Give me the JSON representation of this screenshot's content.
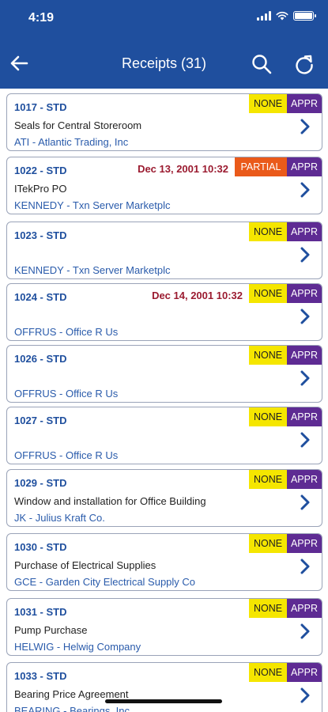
{
  "status": {
    "time": "4:19"
  },
  "nav": {
    "title": "Receipts (31)"
  },
  "receipts": [
    {
      "id": "1017 - STD",
      "description": "Seals for Central Storeroom",
      "vendor": "ATI - Atlantic Trading, Inc",
      "date": "",
      "receive_status": "NONE",
      "approval": "APPR"
    },
    {
      "id": "1022 - STD",
      "description": "ITekPro PO",
      "vendor": "KENNEDY - Txn Server Marketplc",
      "date": "Dec 13, 2001 10:32",
      "receive_status": "PARTIAL",
      "approval": "APPR"
    },
    {
      "id": "1023 - STD",
      "description": "",
      "vendor": "KENNEDY - Txn Server Marketplc",
      "date": "",
      "receive_status": "NONE",
      "approval": "APPR"
    },
    {
      "id": "1024 - STD",
      "description": "",
      "vendor": "OFFRUS - Office R Us",
      "date": "Dec 14, 2001 10:32",
      "receive_status": "NONE",
      "approval": "APPR"
    },
    {
      "id": "1026 - STD",
      "description": "",
      "vendor": "OFFRUS - Office R Us",
      "date": "",
      "receive_status": "NONE",
      "approval": "APPR"
    },
    {
      "id": "1027 - STD",
      "description": "",
      "vendor": "OFFRUS - Office R Us",
      "date": "",
      "receive_status": "NONE",
      "approval": "APPR"
    },
    {
      "id": "1029 - STD",
      "description": "Window and installation for Office Building",
      "vendor": "JK - Julius Kraft Co.",
      "date": "",
      "receive_status": "NONE",
      "approval": "APPR"
    },
    {
      "id": "1030 - STD",
      "description": "Purchase of Electrical Supplies",
      "vendor": "GCE - Garden City Electrical Supply Co",
      "date": "",
      "receive_status": "NONE",
      "approval": "APPR"
    },
    {
      "id": "1031 - STD",
      "description": "Pump Purchase",
      "vendor": "HELWIG - Helwig Company",
      "date": "",
      "receive_status": "NONE",
      "approval": "APPR"
    },
    {
      "id": "1033 - STD",
      "description": "Bearing Price Agreement",
      "vendor": "BEARING - Bearings, Inc",
      "date": "",
      "receive_status": "NONE",
      "approval": "APPR"
    }
  ],
  "icons": {
    "back": "arrow-left-icon",
    "search": "search-icon",
    "refresh": "refresh-icon",
    "chevron": "chevron-right-icon"
  },
  "colors": {
    "header": "#1f4f9e",
    "none_badge": "#f5e600",
    "partial_badge": "#ea5a1a",
    "appr_badge": "#5e2b93",
    "date_text": "#9b1b30"
  }
}
